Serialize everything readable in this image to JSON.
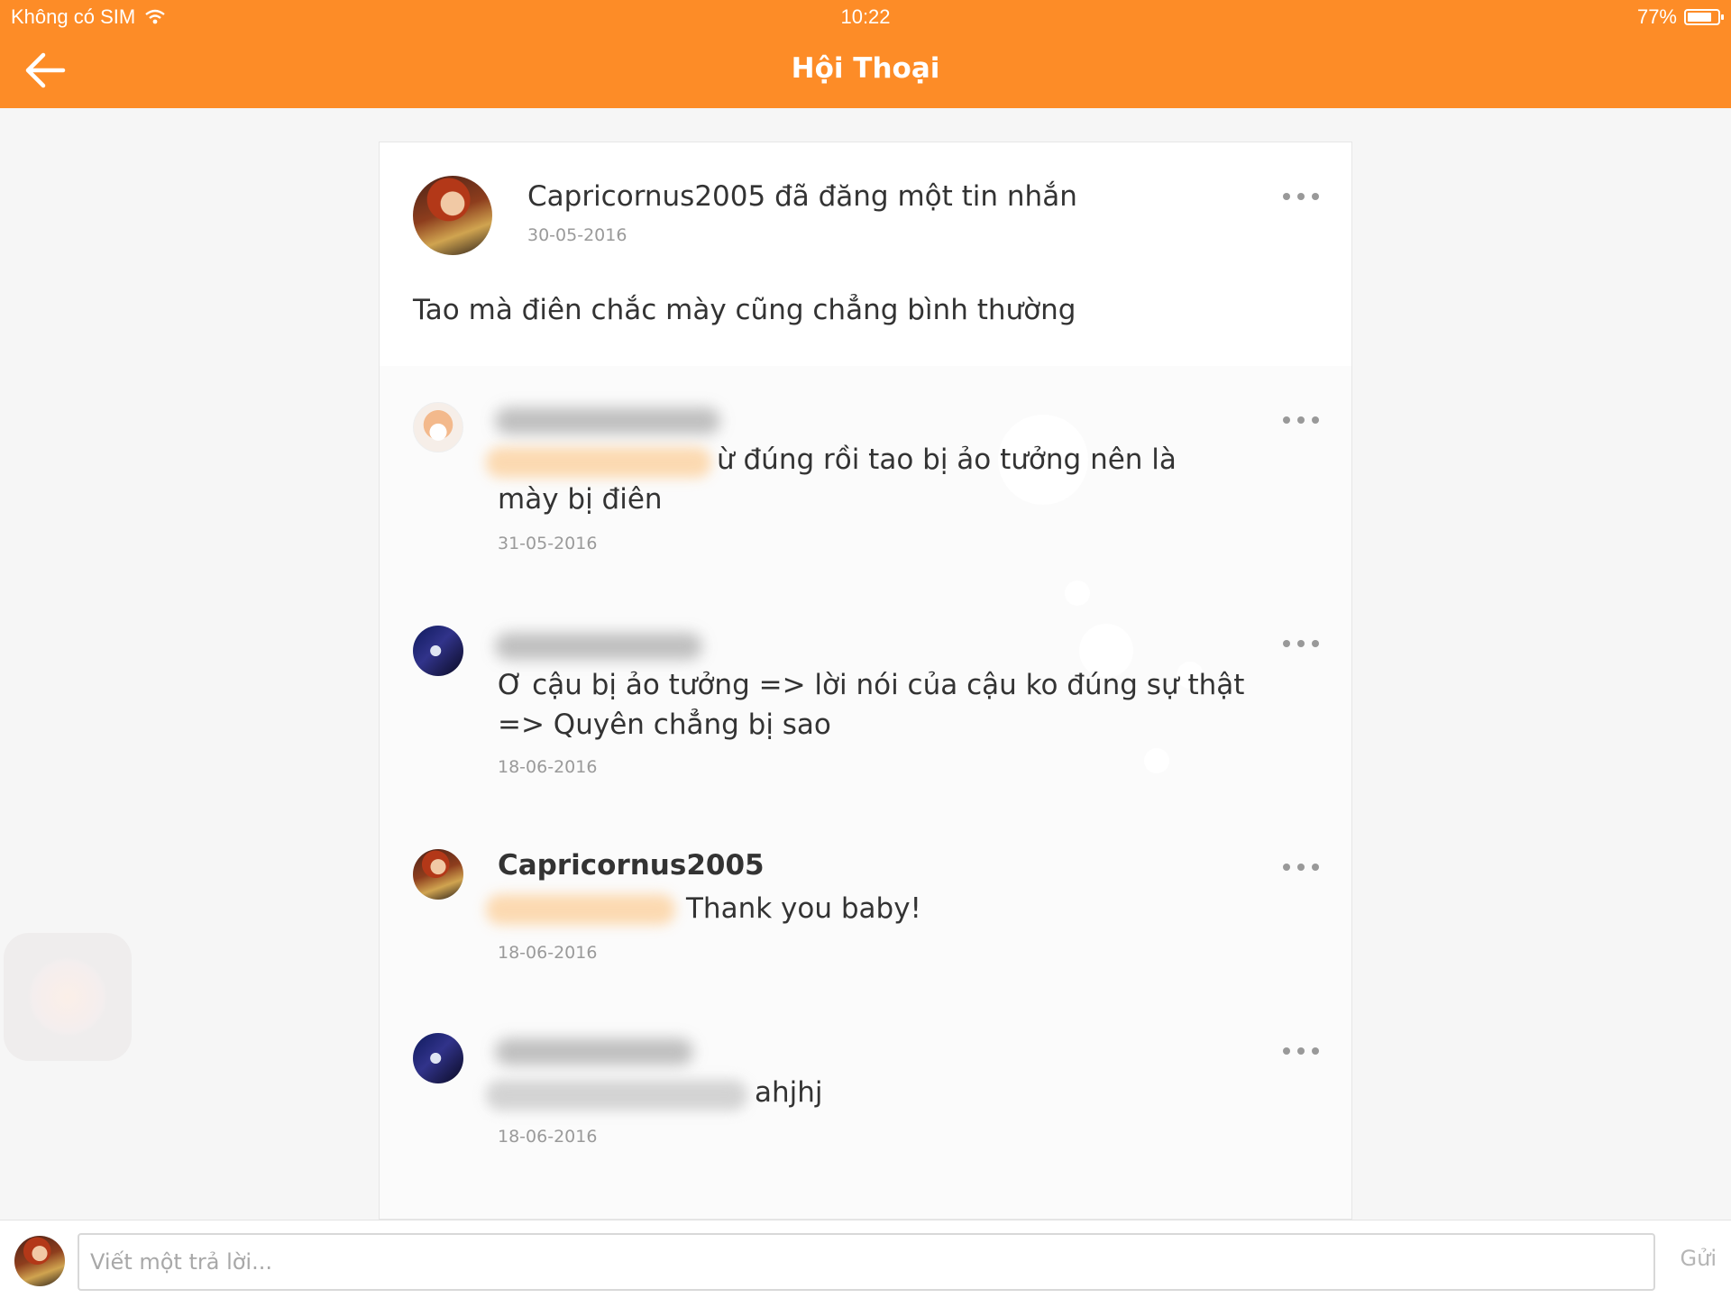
{
  "status_bar": {
    "carrier": "Không có SIM",
    "time": "10:22",
    "battery": "77%"
  },
  "header": {
    "title": "Hội Thoại",
    "accent_color": "#fd8c27"
  },
  "post": {
    "title": "Capricornus2005 đã đăng một tin nhắn",
    "date": "30-05-2016",
    "body": "Tao mà điên chắc mày cũng chẳng bình thường"
  },
  "comments": [
    {
      "text_line1": "ừ đúng rồi tao bị ảo tưởng nên là",
      "text_line2": "mày bị điên",
      "date": "31-05-2016"
    },
    {
      "text_line1": "Ơ cậu bị ảo tưởng => lời nói của cậu ko đúng sự thật",
      "text_line2": "=> Quyên chẳng bị sao",
      "date": "18-06-2016"
    },
    {
      "author": "Capricornus2005",
      "text": "Thank you baby!",
      "date": "18-06-2016"
    },
    {
      "text": "ahjhj",
      "date": "18-06-2016"
    }
  ],
  "reply": {
    "placeholder": "Viết một trả lời...",
    "send_label": "Gửi"
  }
}
